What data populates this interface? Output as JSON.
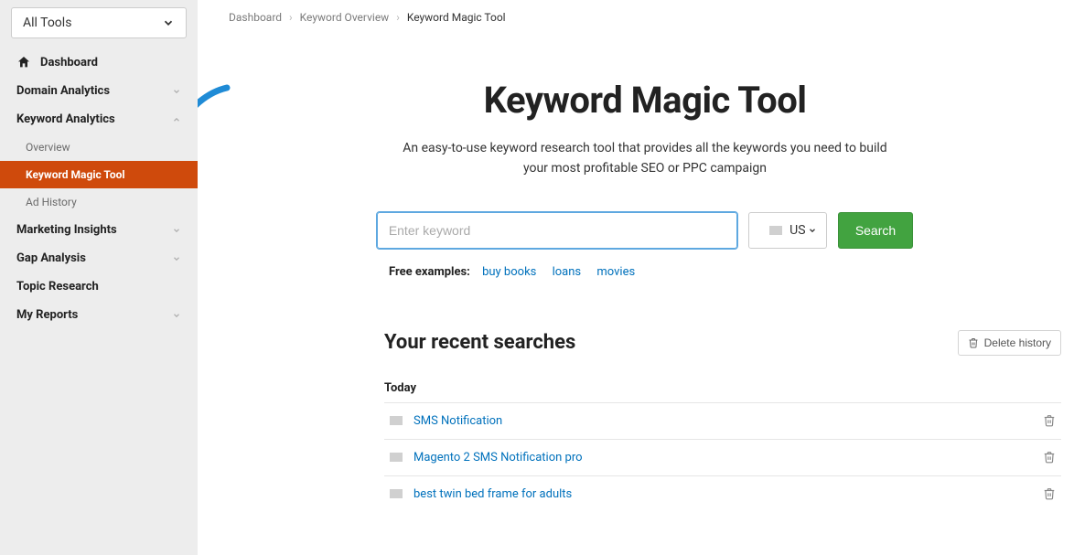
{
  "sidebar": {
    "tools_selector": "All Tools",
    "dashboard": "Dashboard",
    "groups": [
      {
        "label": "Domain Analytics",
        "expanded": false
      },
      {
        "label": "Keyword Analytics",
        "expanded": true
      },
      {
        "label": "Marketing Insights",
        "expanded": false
      },
      {
        "label": "Gap Analysis",
        "expanded": false
      },
      {
        "label": "Topic Research",
        "expanded": null
      },
      {
        "label": "My Reports",
        "expanded": false
      }
    ],
    "keyword_sub": [
      {
        "label": "Overview",
        "active": false
      },
      {
        "label": "Keyword Magic Tool",
        "active": true
      },
      {
        "label": "Ad History",
        "active": false
      }
    ]
  },
  "breadcrumbs": [
    "Dashboard",
    "Keyword Overview",
    "Keyword Magic Tool"
  ],
  "hero": {
    "title": "Keyword Magic Tool",
    "subtitle": "An easy-to-use keyword research tool that provides all the keywords you need to build your most profitable SEO or PPC campaign",
    "placeholder": "Enter keyword",
    "country": "US",
    "search_btn": "Search",
    "examples_label": "Free examples:",
    "examples": [
      "buy books",
      "loans",
      "movies"
    ]
  },
  "recent": {
    "heading": "Your recent searches",
    "delete_btn": "Delete history",
    "today_label": "Today",
    "items": [
      "SMS Notification",
      "Magento 2 SMS Notification pro",
      "best twin bed frame for adults"
    ]
  },
  "colors": {
    "accent_orange": "#cf4a0c",
    "green": "#42a340",
    "link": "#0071bc",
    "arrow": "#1f8bd6"
  }
}
